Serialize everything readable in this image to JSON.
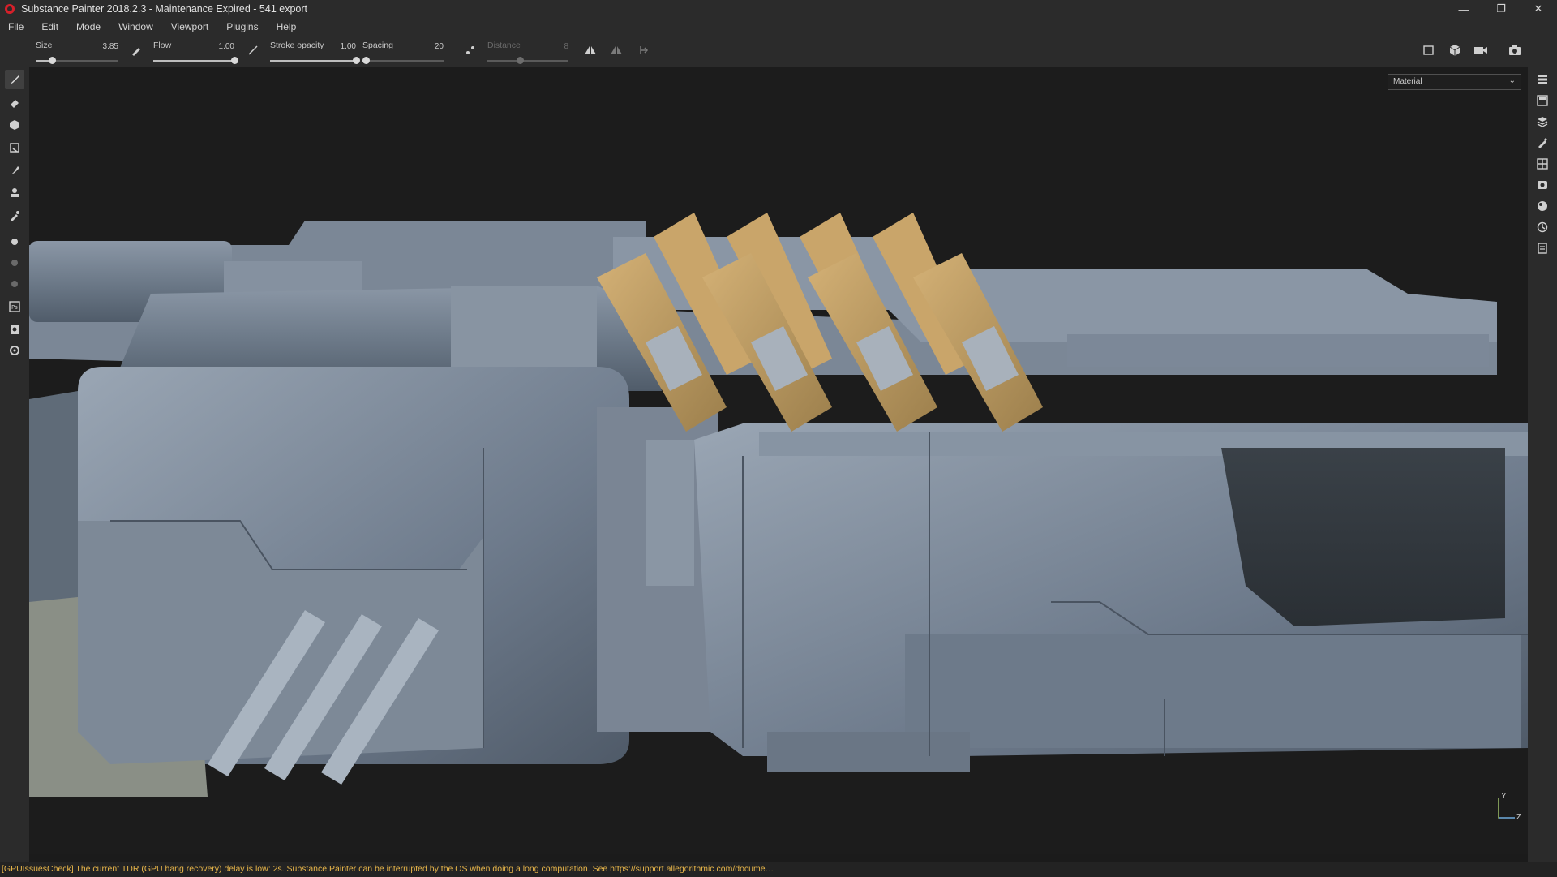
{
  "window": {
    "title": "Substance Painter 2018.2.3 - Maintenance Expired - 541 export",
    "controls": [
      "minimize-icon",
      "restore-icon",
      "close-icon"
    ]
  },
  "menu": [
    "File",
    "Edit",
    "Mode",
    "Window",
    "Viewport",
    "Plugins",
    "Help"
  ],
  "toolbar": {
    "size": {
      "label": "Size",
      "value": "3.85",
      "fraction": 0.2
    },
    "flow": {
      "label": "Flow",
      "value": "1.00",
      "fraction": 1.0
    },
    "stroke_opacity": {
      "label": "Stroke opacity",
      "value": "1.00",
      "fraction": 1.0
    },
    "spacing": {
      "label": "Spacing",
      "value": "20",
      "fraction": 0.04
    },
    "distance": {
      "label": "Distance",
      "value": "8",
      "fraction": 0.4,
      "disabled": true
    },
    "left_icons": [
      "brush-tip-icon",
      "pen-pressure-icon",
      "lazy-mouse-icon"
    ],
    "symmetry_icons": [
      "symmetry-x-icon",
      "symmetry-y-icon",
      "symmetry-options-icon"
    ],
    "view_icons": [
      "camera-2d-icon",
      "camera-3d-icon",
      "camera-settings-icon",
      "screenshot-icon"
    ]
  },
  "left_tools": [
    "paint-brush-icon",
    "eraser-icon",
    "projection-icon",
    "polygon-fill-icon",
    "smudge-icon",
    "clone-icon",
    "color-picker-icon",
    "bake-icon",
    "particle-icon",
    "physics-icon",
    "photoshop-export-icon",
    "export-icon",
    "settings-icon"
  ],
  "right_tools": [
    "texture-set-list-icon",
    "texture-set-settings-icon",
    "layers-icon",
    "properties-icon",
    "display-settings-icon",
    "viewer-settings-icon",
    "shelf-icon",
    "history-icon",
    "log-icon"
  ],
  "viewport": {
    "channel_select": "Material",
    "axis_labels": [
      "Y",
      "Z"
    ]
  },
  "status": {
    "message": "[GPUIssuesCheck] The current TDR (GPU hang recovery) delay is low: 2s. Substance Painter can be interrupted by the OS when doing a long computation. See https://support.allegorithmic.com/docume…",
    "color": "#e8b64a"
  }
}
